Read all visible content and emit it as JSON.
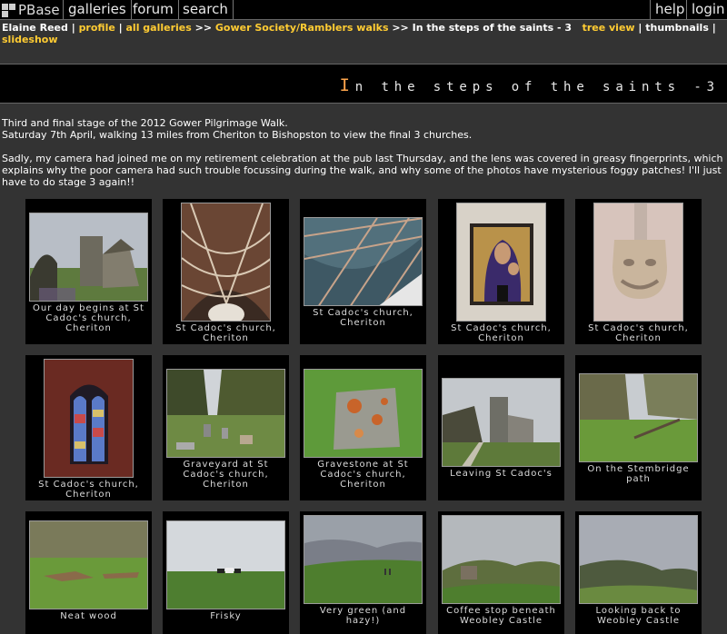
{
  "nav": {
    "logo": "PBase",
    "links": [
      "galleries",
      "forum",
      "search"
    ],
    "right": [
      "help",
      "login"
    ]
  },
  "breadcrumb": {
    "owner": "Elaine Reed",
    "sep1": " | ",
    "profile": "profile",
    "sep2": " | ",
    "all_galleries": "all galleries",
    "arrow1": " >> ",
    "parent": "Gower Society/Ramblers walks",
    "arrow2": " >> ",
    "current": "In the steps of the saints - 3",
    "tree_view": "tree view",
    "sep3": " | ",
    "thumbnails": "thumbnails",
    "sep4": " | ",
    "slideshow": "slideshow"
  },
  "gallery_title": {
    "first_letter": "I",
    "rest": "n the steps of the saints -3"
  },
  "description": [
    "Third and final stage of the 2012 Gower Pilgrimage Walk.",
    "Saturday 7th April, walking 13 miles from Cheriton to Bishopston to view the final 3 churches.",
    "Sadly, my camera had joined me on my retirement celebration at the pub last Thursday, and the lens was covered in greasy fingerprints, which explains why the poor camera had such trouble focussing during the walk, and why some of the photos have mysterious foggy patches! I'll just have to do stage 3 again!!"
  ],
  "thumbnails": [
    {
      "caption": "Our day begins at St Cadoc's church, Cheriton",
      "subject": "church-photo"
    },
    {
      "caption": "St Cadoc's church, Cheriton",
      "subject": "barrel-roof-photo"
    },
    {
      "caption": "St Cadoc's church, Cheriton",
      "subject": "ceiling-photo"
    },
    {
      "caption": "St Cadoc's church, Cheriton",
      "subject": "icon-painting-photo"
    },
    {
      "caption": "St Cadoc's church, Cheriton",
      "subject": "stone-carving-photo"
    },
    {
      "caption": "St Cadoc's church, Cheriton",
      "subject": "stained-glass-photo"
    },
    {
      "caption": "Graveyard at St Cadoc's church, Cheriton",
      "subject": "graveyard-photo"
    },
    {
      "caption": "Gravestone at St Cadoc's church, Cheriton",
      "subject": "gravestone-photo"
    },
    {
      "caption": "Leaving St Cadoc's",
      "subject": "church-tower-photo"
    },
    {
      "caption": "On the Stembridge path",
      "subject": "woodland-path-photo"
    },
    {
      "caption": "Neat wood",
      "subject": "field-woodpile-photo"
    },
    {
      "caption": "Frisky",
      "subject": "cattle-field-photo"
    },
    {
      "caption": "Very green (and hazy!)",
      "subject": "green-field-photo"
    },
    {
      "caption": "Coffee stop beneath Weobley Castle",
      "subject": "hillside-photo"
    },
    {
      "caption": "Looking back to Weobley Castle",
      "subject": "valley-view-photo"
    }
  ],
  "colors": {
    "background": "#333333",
    "link": "#ffcc33",
    "title_accent": "#ffa64d",
    "tile": "#000000"
  }
}
